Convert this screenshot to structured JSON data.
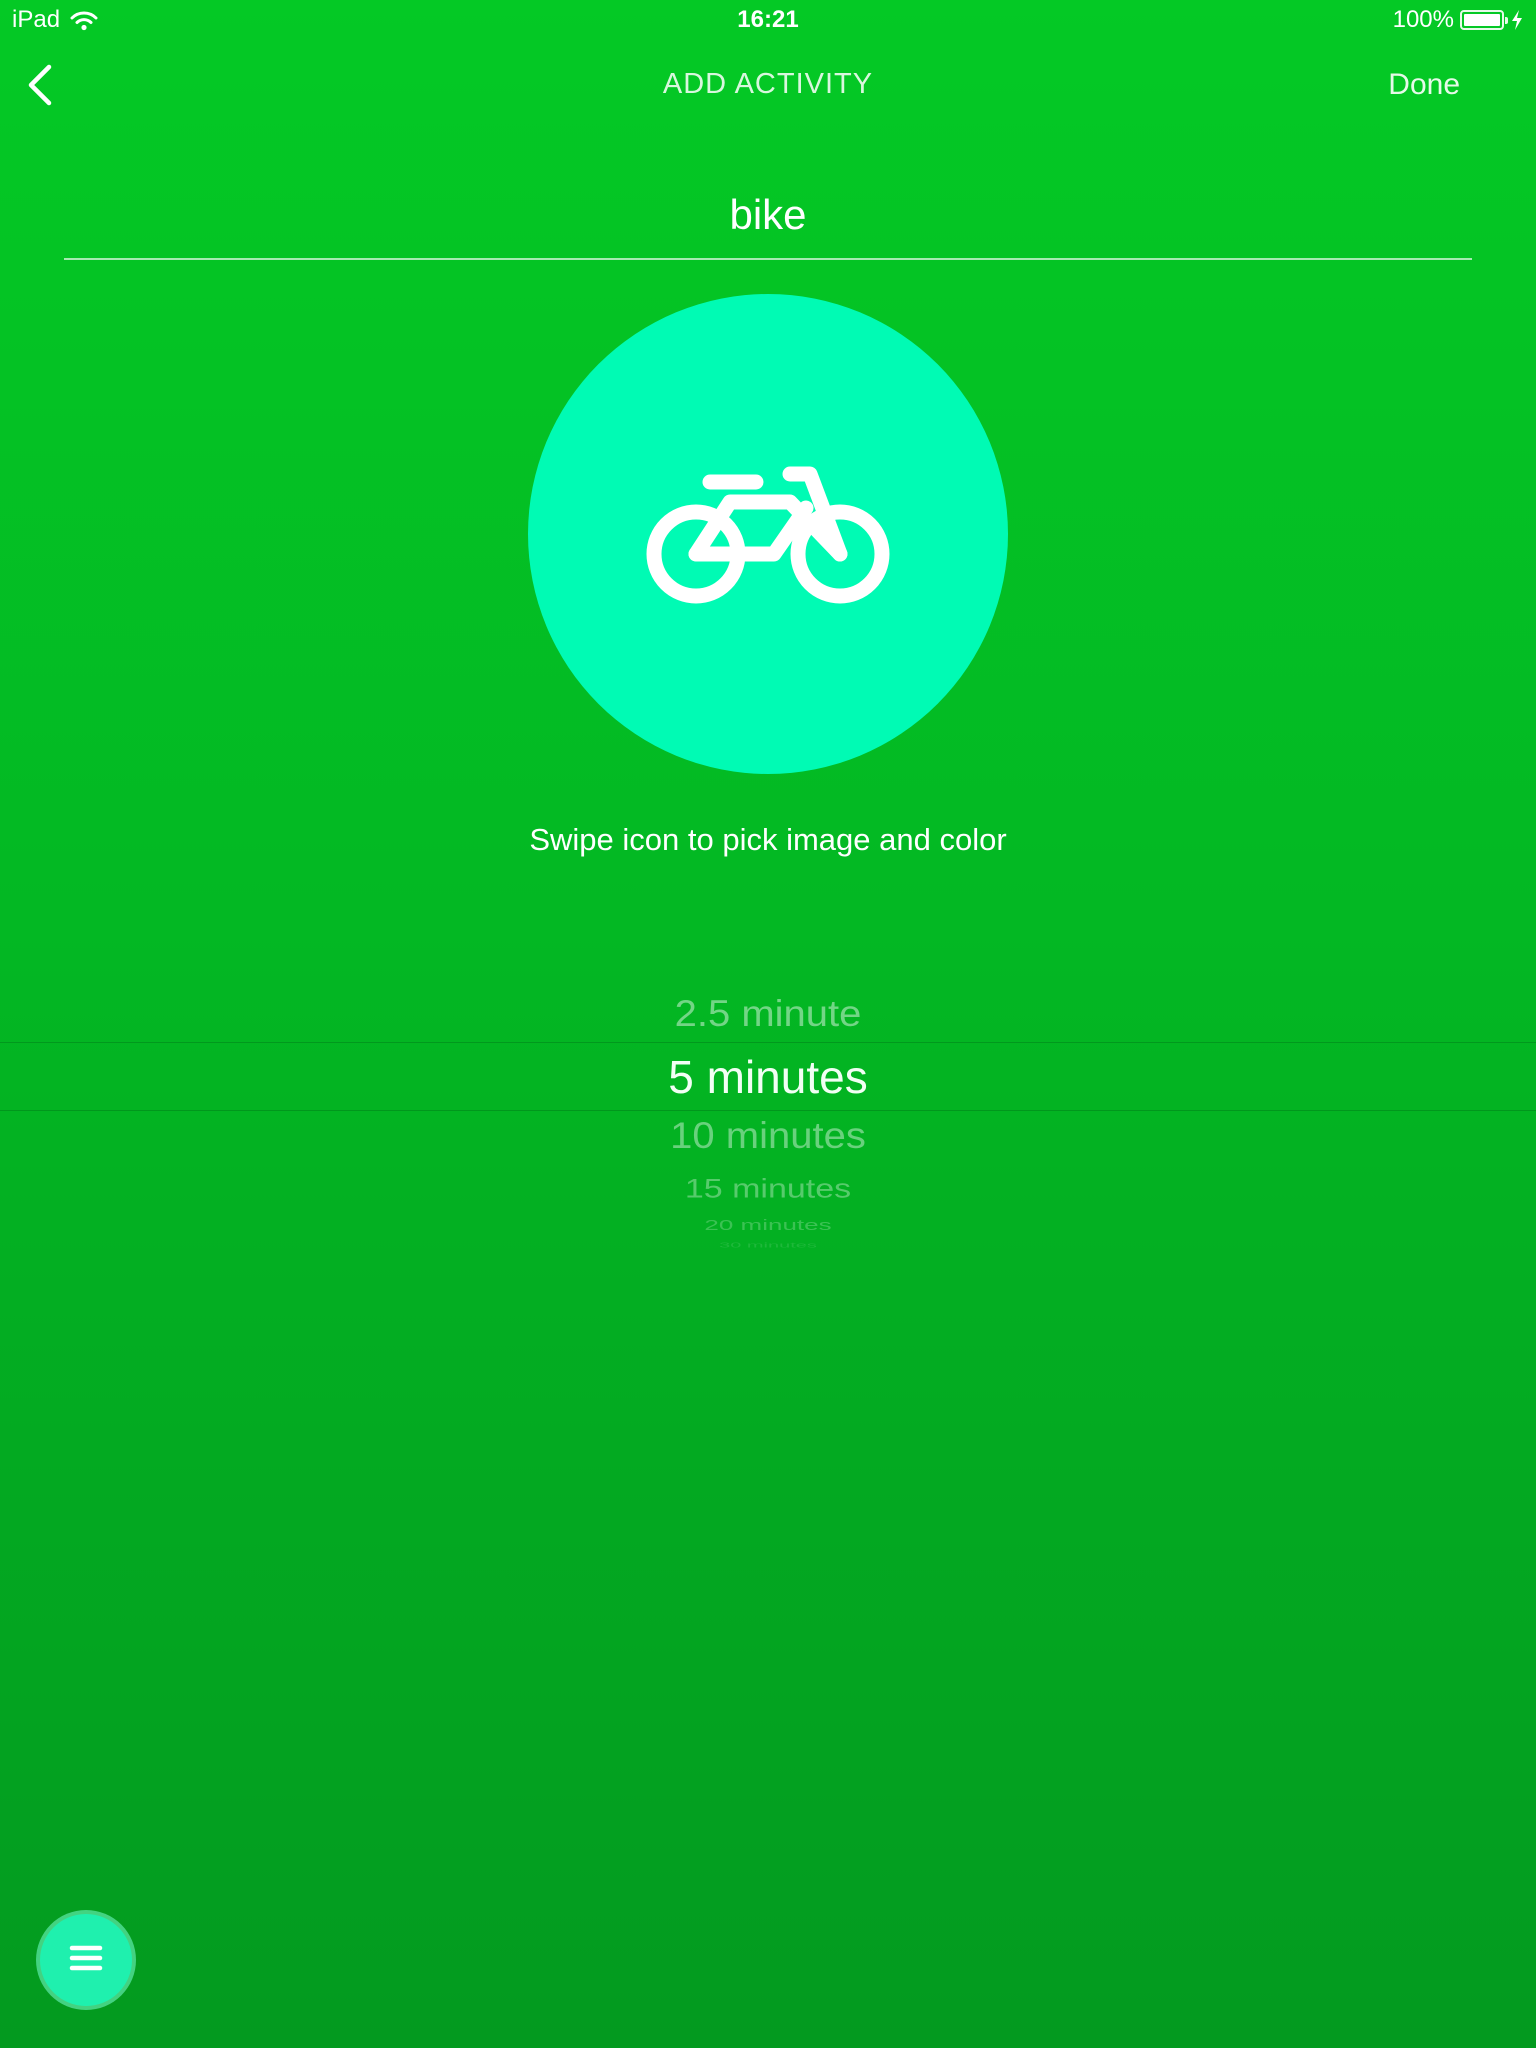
{
  "status_bar": {
    "device": "iPad",
    "time": "16:21",
    "battery_percent": "100%",
    "battery_level": 1.0
  },
  "nav": {
    "title": "ADD ACTIVITY",
    "done_label": "Done",
    "back_icon": "chevron-left-icon"
  },
  "activity": {
    "name": "bike",
    "icon": "bicycle-icon",
    "icon_color": "#00fbb4",
    "hint": "Swipe icon to pick image and color"
  },
  "picker": {
    "options": [
      "2.5 minute",
      "5 minutes",
      "10 minutes",
      "15 minutes",
      "20 minutes",
      "30 minutes"
    ],
    "selected": "5 minutes"
  },
  "fab": {
    "icon": "menu-icon"
  },
  "colors": {
    "background_top": "#04c925",
    "background_bottom": "#039a1f",
    "accent": "#00fbb4"
  }
}
